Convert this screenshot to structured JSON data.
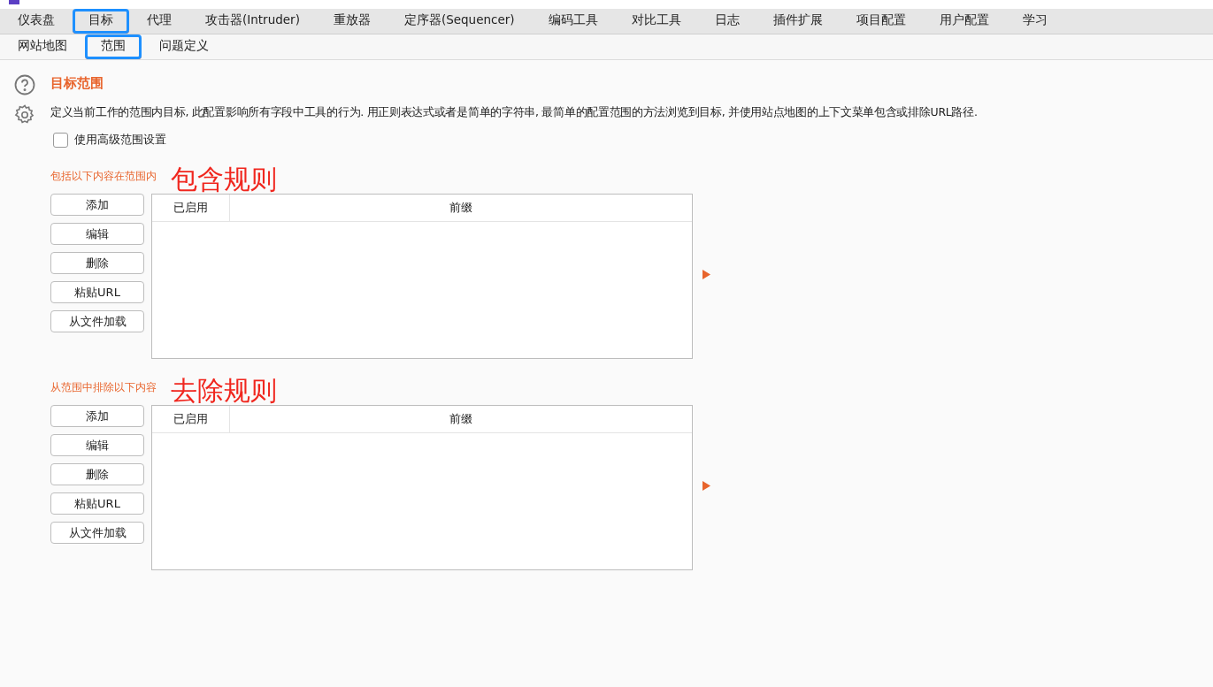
{
  "main_tabs": [
    {
      "label": "仪表盘",
      "selected": false,
      "annotated": false
    },
    {
      "label": "目标",
      "selected": true,
      "annotated": true
    },
    {
      "label": "代理",
      "selected": false,
      "annotated": false
    },
    {
      "label": "攻击器(Intruder)",
      "selected": false,
      "annotated": false
    },
    {
      "label": "重放器",
      "selected": false,
      "annotated": false
    },
    {
      "label": "定序器(Sequencer)",
      "selected": false,
      "annotated": false
    },
    {
      "label": "编码工具",
      "selected": false,
      "annotated": false
    },
    {
      "label": "对比工具",
      "selected": false,
      "annotated": false
    },
    {
      "label": "日志",
      "selected": false,
      "annotated": false
    },
    {
      "label": "插件扩展",
      "selected": false,
      "annotated": false
    },
    {
      "label": "项目配置",
      "selected": false,
      "annotated": false
    },
    {
      "label": "用户配置",
      "selected": false,
      "annotated": false
    },
    {
      "label": "学习",
      "selected": false,
      "annotated": false
    }
  ],
  "sub_tabs": [
    {
      "label": "网站地图",
      "selected": false,
      "annotated": false
    },
    {
      "label": "范围",
      "selected": true,
      "annotated": true
    },
    {
      "label": "问题定义",
      "selected": false,
      "annotated": false
    }
  ],
  "scope": {
    "title": "目标范围",
    "description": "定义当前工作的范围内目标, 此配置影响所有字段中工具的行为. 用正则表达式或者是简单的字符串, 最简单的配置范围的方法浏览到目标, 并使用站点地图的上下文菜单包含或排除URL路径.",
    "advanced_checkbox": {
      "label": "使用高级范围设置",
      "checked": false
    }
  },
  "sections": [
    {
      "label": "包括以下内容在范围内",
      "annotation": "包含规则",
      "buttons": [
        "添加",
        "编辑",
        "删除",
        "粘贴URL",
        "从文件加载"
      ],
      "table": {
        "columns": [
          "已启用",
          "前缀"
        ]
      }
    },
    {
      "label": "从范围中排除以下内容",
      "annotation": "去除规则",
      "buttons": [
        "添加",
        "编辑",
        "删除",
        "粘贴URL",
        "从文件加载"
      ],
      "table": {
        "columns": [
          "已启用",
          "前缀"
        ]
      }
    }
  ]
}
